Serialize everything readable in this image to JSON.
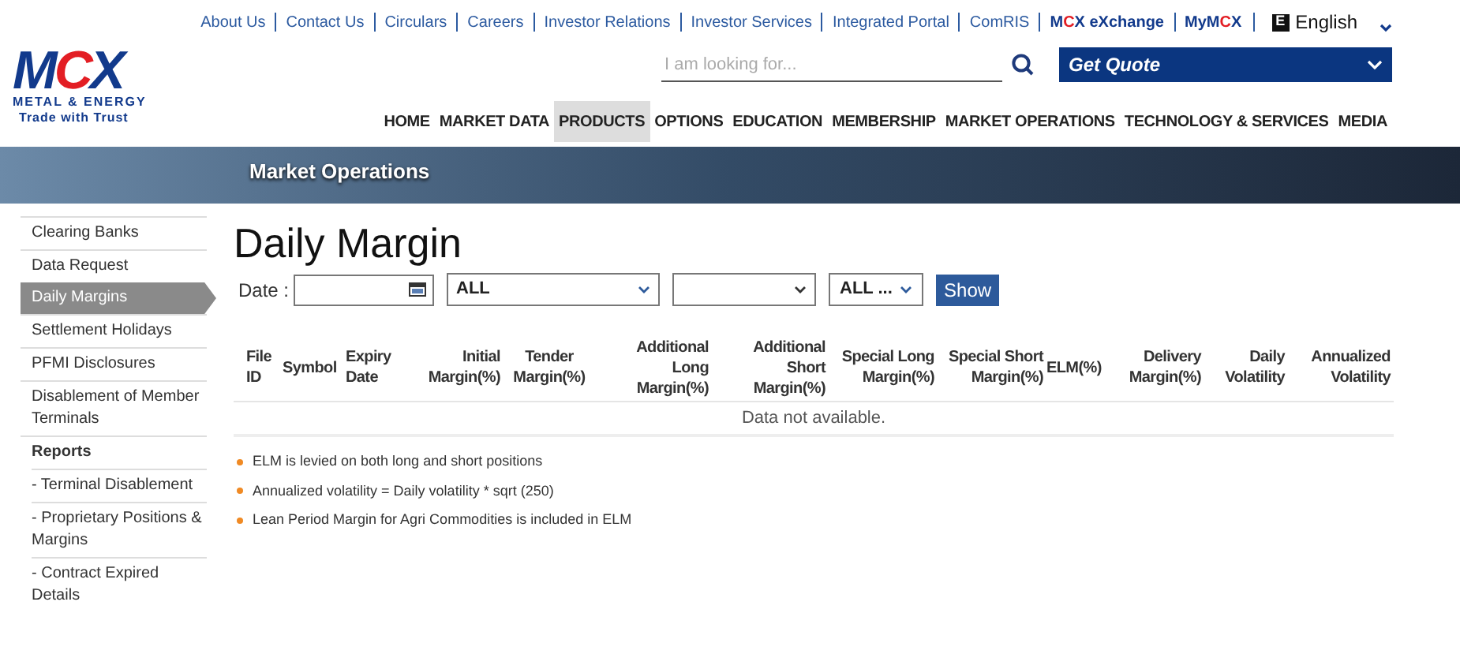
{
  "top_links": [
    {
      "parts": [
        {
          "text": "About Us",
          "accent": false
        }
      ],
      "bold": false
    },
    {
      "parts": [
        {
          "text": "Contact Us",
          "accent": false
        }
      ],
      "bold": false
    },
    {
      "parts": [
        {
          "text": "Circulars",
          "accent": false
        }
      ],
      "bold": false
    },
    {
      "parts": [
        {
          "text": "Careers",
          "accent": false
        }
      ],
      "bold": false
    },
    {
      "parts": [
        {
          "text": "Investor Relations",
          "accent": false
        }
      ],
      "bold": false
    },
    {
      "parts": [
        {
          "text": "Investor Services",
          "accent": false
        }
      ],
      "bold": false
    },
    {
      "parts": [
        {
          "text": "Integrated Portal",
          "accent": false
        }
      ],
      "bold": false
    },
    {
      "parts": [
        {
          "text": "ComRIS",
          "accent": false
        }
      ],
      "bold": false
    },
    {
      "parts": [
        {
          "text": "M",
          "accent": false
        },
        {
          "text": "C",
          "accent": true
        },
        {
          "text": "X eXchange",
          "accent": false
        }
      ],
      "bold": true
    },
    {
      "parts": [
        {
          "text": "MyM",
          "accent": false
        },
        {
          "text": "C",
          "accent": true
        },
        {
          "text": "X",
          "accent": false
        }
      ],
      "bold": true
    }
  ],
  "language": {
    "badge": "E",
    "label": "English"
  },
  "logo": {
    "parts": [
      {
        "text": "M",
        "accent": false
      },
      {
        "text": "C",
        "accent": true
      },
      {
        "text": "X",
        "accent": false
      }
    ],
    "line1": "METAL & ENERGY",
    "line2": "Trade with Trust"
  },
  "search": {
    "placeholder": "I am looking for..."
  },
  "quote": {
    "label": "Get Quote"
  },
  "nav": [
    {
      "label": "HOME",
      "selected": false
    },
    {
      "label": "MARKET DATA",
      "selected": false
    },
    {
      "label": "PRODUCTS",
      "selected": true
    },
    {
      "label": "OPTIONS",
      "selected": false
    },
    {
      "label": "EDUCATION",
      "selected": false
    },
    {
      "label": "MEMBERSHIP",
      "selected": false
    },
    {
      "label": "MARKET OPERATIONS",
      "selected": false
    },
    {
      "label": "TECHNOLOGY & SERVICES",
      "selected": false
    },
    {
      "label": "MEDIA",
      "selected": false
    }
  ],
  "banner": {
    "title": "Market Operations"
  },
  "sidebar": {
    "items": [
      {
        "label": "Clearing Banks",
        "kind": "link",
        "selected": false
      },
      {
        "label": "Data Request",
        "kind": "link",
        "selected": false
      },
      {
        "label": "Daily Margins",
        "kind": "link",
        "selected": true
      },
      {
        "label": "Settlement Holidays",
        "kind": "link",
        "selected": false
      },
      {
        "label": "PFMI Disclosures",
        "kind": "link",
        "selected": false
      },
      {
        "label": "Disablement of Member Terminals",
        "kind": "link",
        "selected": false
      },
      {
        "label": "Reports",
        "kind": "heading",
        "selected": false
      },
      {
        "label": "- Terminal Disablement",
        "kind": "sublink",
        "selected": false
      },
      {
        "label": "- Proprietary Positions & Margins",
        "kind": "sublink",
        "selected": false
      },
      {
        "label": "- Contract Expired Details",
        "kind": "sublink",
        "selected": false
      }
    ]
  },
  "page_title": "Daily Margin",
  "filters": {
    "date_label": "Date :",
    "select_1": "ALL",
    "select_3": "ALL ...",
    "button": "Show"
  },
  "table": {
    "columns": [
      "File ID",
      "Symbol",
      "Expiry Date",
      "Initial Margin(%)",
      "Tender Margin(%)",
      "Additional Long Margin(%)",
      "Additional Short Margin(%)",
      "Special Long Margin(%)",
      "Special Short Margin(%)",
      "ELM(%)",
      "Delivery Margin(%)",
      "Daily Volatility",
      "Annualized Volatility"
    ],
    "empty_message": "Data not available."
  },
  "notes": [
    "ELM is levied on both long and short positions",
    "Annualized volatility = Daily volatility * sqrt (250)",
    "Lean Period Margin for Agri Commodities is included in ELM"
  ]
}
